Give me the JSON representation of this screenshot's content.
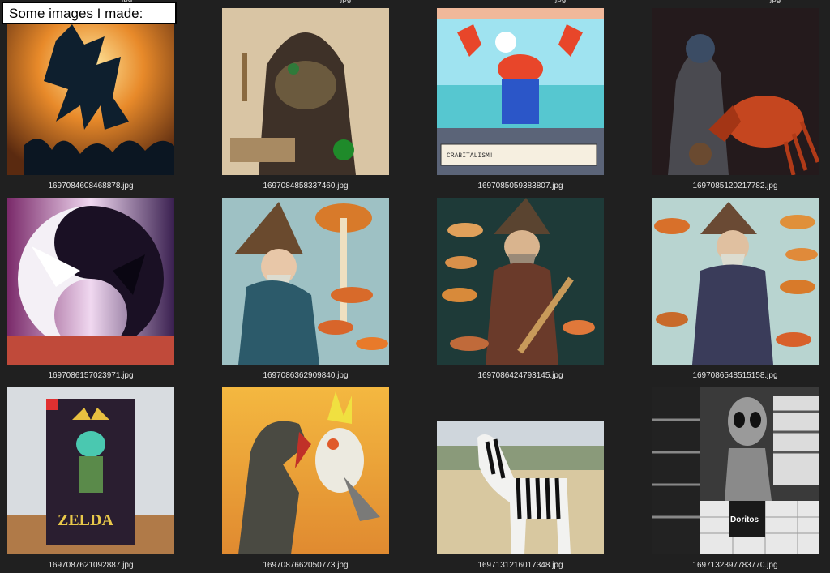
{
  "overlay": {
    "caption": "Some images I made:"
  },
  "top_cut_labels": [
    "jpg",
    "jpg",
    "jpg",
    "jpg"
  ],
  "files": [
    {
      "name": "1697084608468878.jpg",
      "subject": "guitar-creature-crowd"
    },
    {
      "name": "1697084858337460.jpg",
      "subject": "hooded-alchemist-frog"
    },
    {
      "name": "1697085059383807.jpg",
      "subject": "pixel-crab-businessman",
      "caption_text": "CRABITALISM!"
    },
    {
      "name": "1697085120217782.jpg",
      "subject": "hooded-figure-crab"
    },
    {
      "name": "1697086157023971.jpg",
      "subject": "white-bird-vs-dark-dragon"
    },
    {
      "name": "1697086362909840.jpg",
      "subject": "wizard-with-mushrooms"
    },
    {
      "name": "1697086424793145.jpg",
      "subject": "wizard-with-mushrooms"
    },
    {
      "name": "1697086548515158.jpg",
      "subject": "wizard-with-mushrooms"
    },
    {
      "name": "1697087621092887.jpg",
      "subject": "zelda-game-box",
      "box_text": "ZELDA"
    },
    {
      "name": "1697087662050773.jpg",
      "subject": "dinosaur-and-cockatiel"
    },
    {
      "name": "1697131216017348.jpg",
      "subject": "zebra-in-grassland"
    },
    {
      "name": "1697132397783770.jpg",
      "subject": "alien-in-store",
      "bag_text": "Doritos"
    }
  ]
}
